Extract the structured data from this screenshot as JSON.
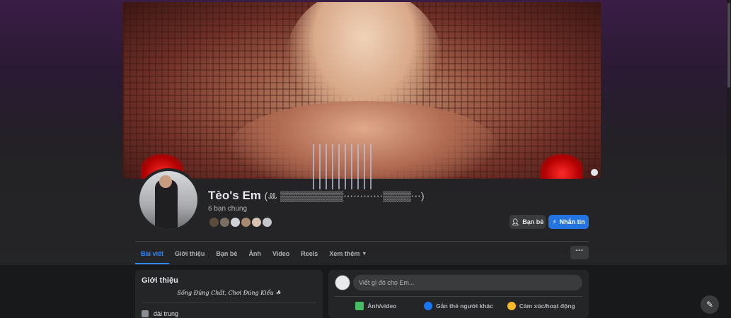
{
  "profile": {
    "name": "Tèo's Em",
    "name_decoration": "(ꔛ ▒▒▒▒▒▒▒▒▒⋯⋯⋯⋯▒▒▒▒⋯)",
    "mutual_friends": "6 bạn chung",
    "friend_avatar_colors": [
      "#5b4d3e",
      "#7a6e62",
      "#cfd1d4",
      "#a88a70",
      "#d8c3b2",
      "#c4c6c9"
    ]
  },
  "actions": {
    "friends_label": "Bạn bè",
    "message_label": "Nhắn tin",
    "more_label": "···"
  },
  "tabs": [
    {
      "label": "Bài viết",
      "active": true
    },
    {
      "label": "Giới thiệu"
    },
    {
      "label": "Bạn bè"
    },
    {
      "label": "Ảnh"
    },
    {
      "label": "Video"
    },
    {
      "label": "Reels"
    },
    {
      "label": "Xem thêm"
    }
  ],
  "intro": {
    "title": "Giới thiệu",
    "bio": "Sống Đúng Chất, Chơi Đúng Kiểu ☘",
    "detail_1": "dài trung"
  },
  "composer": {
    "placeholder": "Viết gì đó cho Em...",
    "photo_label": "Ảnh/video",
    "tag_label": "Gắn thẻ người khác",
    "feeling_label": "Cảm xúc/hoạt động"
  },
  "colors": {
    "accent": "#2d88ff",
    "message_button": "#2374e1",
    "background": "#18191a",
    "card": "#242526"
  },
  "icons": {
    "friends": "person-check-icon",
    "message": "messenger-icon",
    "floating": "edit-compose-icon"
  }
}
